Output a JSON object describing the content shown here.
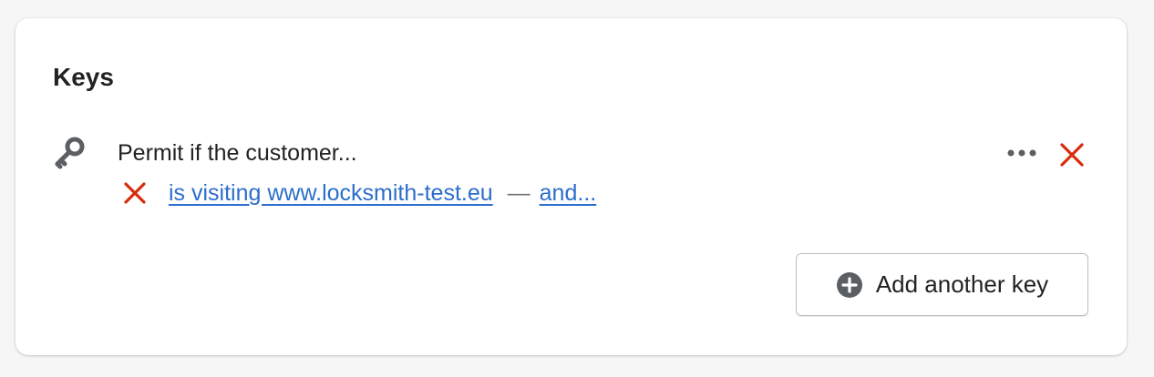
{
  "card": {
    "title": "Keys"
  },
  "key": {
    "icon": "key-icon",
    "heading": "Permit if the customer...",
    "condition": {
      "remove_icon": "close-icon",
      "label": "is visiting www.locksmith-test.eu",
      "separator": "—",
      "and_label": "and..."
    },
    "more_icon": "more-horizontal-icon",
    "remove_icon": "close-icon"
  },
  "add_key_button": {
    "icon": "plus-circle-icon",
    "label": "Add another key"
  },
  "colors": {
    "danger": "#d72c0d",
    "link": "#2c6ecb",
    "icon": "#5c5f62",
    "text": "#202223"
  }
}
